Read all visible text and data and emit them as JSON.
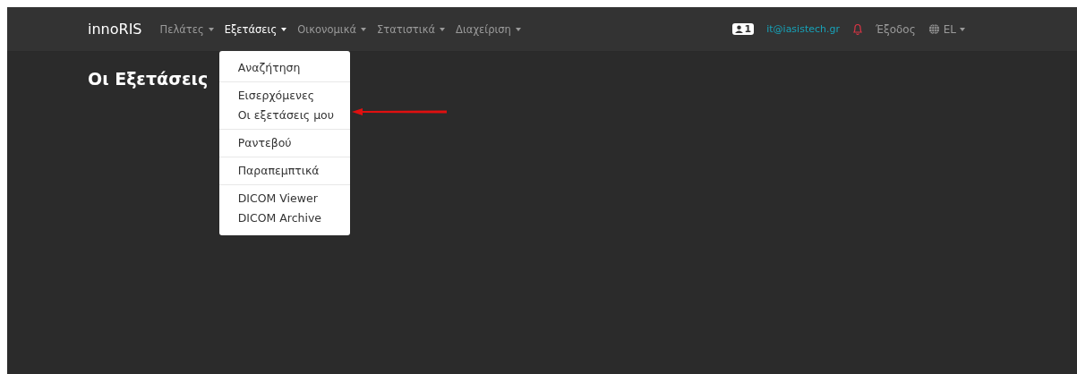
{
  "navbar": {
    "brand": "innoRIS",
    "menus": [
      {
        "label": "Πελάτες",
        "selected": false
      },
      {
        "label": "Εξετάσεις",
        "selected": true
      },
      {
        "label": "Οικονομικά",
        "selected": false
      },
      {
        "label": "Στατιστικά",
        "selected": false
      },
      {
        "label": "Διαχείριση",
        "selected": false
      }
    ],
    "user_badge": "1",
    "user_email": "it@iasistech.gr",
    "logout": "Έξοδος",
    "language": "EL"
  },
  "dropdown": {
    "groups": [
      [
        {
          "label": "Αναζήτηση",
          "pointed": false
        }
      ],
      [
        {
          "label": "Εισερχόμενες",
          "pointed": false
        },
        {
          "label": "Οι εξετάσεις μου",
          "pointed": true
        }
      ],
      [
        {
          "label": "Ραντεβού",
          "pointed": false
        }
      ],
      [
        {
          "label": "Παραπεμπτικά",
          "pointed": false
        }
      ],
      [
        {
          "label": "DICOM Viewer",
          "pointed": false
        },
        {
          "label": "DICOM Archive",
          "pointed": false
        }
      ]
    ]
  },
  "page_title": "Οι Εξετάσεις"
}
